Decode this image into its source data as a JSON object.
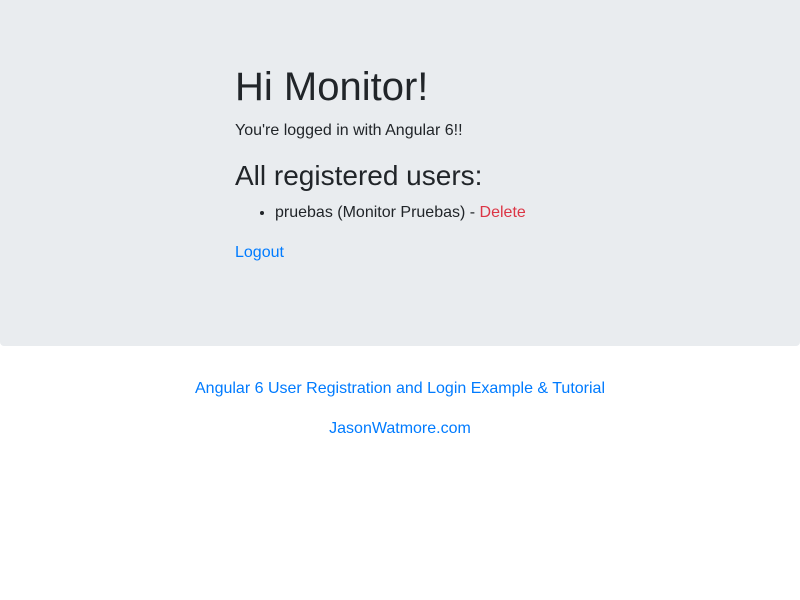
{
  "home": {
    "greeting": "Hi Monitor!",
    "status_text": "You're logged in with Angular 6!!",
    "users_heading": "All registered users:",
    "users": [
      {
        "label": "pruebas (Monitor Pruebas) - ",
        "delete_label": "Delete"
      }
    ],
    "logout_label": "Logout"
  },
  "footer": {
    "tutorial_link": "Angular 6 User Registration and Login Example & Tutorial",
    "site_link": "JasonWatmore.com"
  },
  "colors": {
    "jumbotron_bg": "#e9ecef",
    "link": "#007bff",
    "delete": "#dc3545",
    "text": "#212529"
  }
}
